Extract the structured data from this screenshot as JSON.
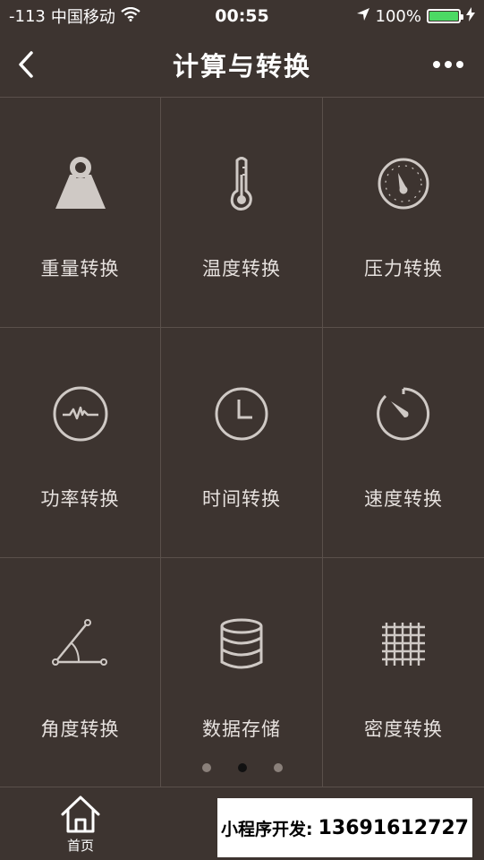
{
  "status_bar": {
    "signal": "-113",
    "carrier": "中国移动",
    "time": "00:55",
    "battery_percent": "100%",
    "battery_level": 1.0,
    "battery_color": "#4cd964"
  },
  "nav": {
    "title": "计算与转换",
    "back_icon": "chevron-left-icon",
    "more_icon": "more-dots-icon"
  },
  "grid_items": [
    {
      "label": "重量转换",
      "icon": "weight-icon"
    },
    {
      "label": "温度转换",
      "icon": "thermometer-icon"
    },
    {
      "label": "压力转换",
      "icon": "pressure-gauge-icon"
    },
    {
      "label": "功率转换",
      "icon": "power-pulse-icon"
    },
    {
      "label": "时间转换",
      "icon": "clock-icon"
    },
    {
      "label": "速度转换",
      "icon": "speedometer-icon"
    },
    {
      "label": "角度转换",
      "icon": "angle-icon"
    },
    {
      "label": "数据存储",
      "icon": "database-icon"
    },
    {
      "label": "密度转换",
      "icon": "grid-density-icon"
    }
  ],
  "pager": {
    "pages": 3,
    "active": 2
  },
  "tab_bar": {
    "home_label": "首页",
    "home_icon": "home-icon"
  },
  "overlay": {
    "prefix": "小程序开发:",
    "phone": "13691612727"
  },
  "colors": {
    "background": "#3d3430",
    "divider": "#5a504b",
    "icon": "#cfc9c5"
  }
}
